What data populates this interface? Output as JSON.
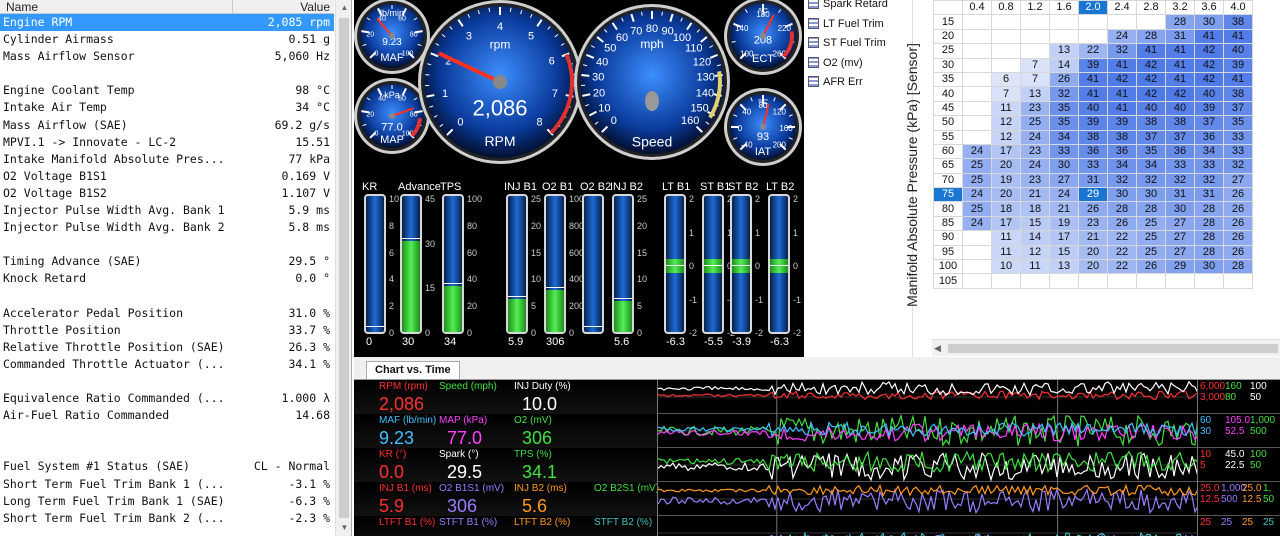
{
  "pid_table": {
    "col_name": "Name",
    "col_value": "Value",
    "rows": [
      {
        "name": "Engine RPM",
        "value": "2,085 rpm",
        "selected": true
      },
      {
        "name": "Cylinder Airmass",
        "value": "0.51 g"
      },
      {
        "name": "Mass Airflow Sensor",
        "value": "5,060 Hz"
      },
      {
        "name": "",
        "value": ""
      },
      {
        "name": "Engine Coolant Temp",
        "value": "98 °C"
      },
      {
        "name": "Intake Air Temp",
        "value": "34 °C"
      },
      {
        "name": "Mass Airflow (SAE)",
        "value": "69.2 g/s"
      },
      {
        "name": "MPVI.1 -> Innovate - LC-2",
        "value": "15.51"
      },
      {
        "name": "Intake Manifold Absolute Pres...",
        "value": "77 kPa"
      },
      {
        "name": "O2 Voltage B1S1",
        "value": "0.169 V"
      },
      {
        "name": "O2 Voltage B1S2",
        "value": "1.107 V"
      },
      {
        "name": "Injector Pulse Width Avg. Bank 1",
        "value": "5.9 ms"
      },
      {
        "name": "Injector Pulse Width Avg. Bank 2",
        "value": "5.8 ms"
      },
      {
        "name": "",
        "value": ""
      },
      {
        "name": "Timing Advance (SAE)",
        "value": "29.5 °"
      },
      {
        "name": "Knock Retard",
        "value": "0.0 °"
      },
      {
        "name": "",
        "value": ""
      },
      {
        "name": "Accelerator Pedal Position",
        "value": "31.0 %"
      },
      {
        "name": "Throttle Position",
        "value": "33.7 %"
      },
      {
        "name": "Relative Throttle Position (SAE)",
        "value": "26.3 %"
      },
      {
        "name": "Commanded Throttle Actuator (...",
        "value": "34.1 %"
      },
      {
        "name": "",
        "value": ""
      },
      {
        "name": "Equivalence Ratio Commanded (...",
        "value": "1.000 λ"
      },
      {
        "name": "Air-Fuel Ratio Commanded",
        "value": "14.68"
      },
      {
        "name": "",
        "value": ""
      },
      {
        "name": "",
        "value": ""
      },
      {
        "name": "Fuel System #1 Status (SAE)",
        "value": "CL - Normal"
      },
      {
        "name": "Short Term Fuel Trim Bank 1 (...",
        "value": "-3.1 %"
      },
      {
        "name": "Long Term Fuel Trim Bank 1 (SAE)",
        "value": "-6.3 %"
      },
      {
        "name": "Short Term Fuel Trim Bank 2 (...",
        "value": "-2.3 %"
      }
    ]
  },
  "gauges": {
    "maf": {
      "unit": "lb/min",
      "value": "9.23",
      "label": "MAF",
      "ticks": [
        "0",
        "20",
        "40",
        "60",
        "80",
        "100"
      ],
      "fraction": 0.35
    },
    "map": {
      "unit": "kPa",
      "value": "77.0",
      "label": "MAP",
      "ticks": [
        "0",
        "20",
        "40",
        "60",
        "80",
        "100"
      ],
      "fraction": 0.76
    },
    "rpm": {
      "unit": "rpm",
      "value": "2,086",
      "label": "RPM",
      "ticks": [
        "0",
        "1",
        "2",
        "3",
        "4",
        "5",
        "6",
        "7",
        "8"
      ],
      "fraction": 0.26
    },
    "speed": {
      "unit": "mph",
      "value": "",
      "label": "Speed",
      "ticks": [
        "0",
        "10",
        "20",
        "30",
        "40",
        "50",
        "60",
        "70",
        "80",
        "90",
        "100",
        "110",
        "120",
        "130",
        "140",
        "150",
        "160"
      ],
      "fraction": 0.0
    },
    "ect": {
      "unit": "°F",
      "value": "208",
      "label": "ECT",
      "ticks": [
        "100",
        "140",
        "180",
        "220",
        "260"
      ],
      "fraction": 0.6
    },
    "iat": {
      "unit": "°F",
      "value": "93",
      "label": "IAT",
      "ticks": [
        "-40",
        "0",
        "40",
        "80",
        "120",
        "160",
        "200"
      ],
      "fraction": 0.55
    }
  },
  "bars": [
    {
      "label": "KR",
      "value": "0",
      "fraction": 0.0,
      "ticks": [
        "10",
        "8",
        "6",
        "4",
        "2",
        "0"
      ]
    },
    {
      "label": "Advance",
      "value": "30",
      "fraction": 0.67,
      "ticks": [
        "45",
        "30",
        "15",
        "0"
      ]
    },
    {
      "label": "TPS",
      "value": "34",
      "fraction": 0.34,
      "ticks": [
        "100",
        "80",
        "60",
        "40",
        "20",
        "0"
      ]
    },
    {
      "label": "INJ B1",
      "value": "5.9",
      "fraction": 0.24,
      "ticks": [
        "25",
        "20",
        "15",
        "10",
        "5",
        "0"
      ]
    },
    {
      "label": "O2 B1",
      "value": "306",
      "fraction": 0.31,
      "ticks": [
        "1000",
        "800",
        "600",
        "400",
        "200",
        "0"
      ]
    },
    {
      "label": "O2 B2",
      "value": "",
      "fraction": 0.0,
      "ticks": []
    },
    {
      "label": "INJ B2",
      "value": "5.6",
      "fraction": 0.23,
      "ticks": [
        "25",
        "20",
        "15",
        "10",
        "5",
        "0"
      ]
    },
    {
      "label": "LT B1",
      "value": "-6.3",
      "fraction": 0.47,
      "ticks": [
        "2",
        "1",
        "0",
        "-1",
        "-2"
      ]
    },
    {
      "label": "ST B1",
      "value": "-5.5",
      "fraction": 0.47,
      "ticks": [
        "2",
        "1",
        "0",
        "-1",
        "-2"
      ]
    },
    {
      "label": "ST B2",
      "value": "-3.9",
      "fraction": 0.47,
      "ticks": [
        "2",
        "1",
        "0",
        "-1",
        "-2"
      ]
    },
    {
      "label": "LT B2",
      "value": "-6.3",
      "fraction": 0.47,
      "ticks": [
        "2",
        "1",
        "0",
        "-1",
        "-2"
      ]
    }
  ],
  "legend_items": [
    "Spark Retard",
    "LT Fuel Trim",
    "ST Fuel Trim",
    "O2 (mv)",
    "AFR Err"
  ],
  "map_table": {
    "ylabel": "Manifold Absolute Pressure (kPa) [Sensor]",
    "columns": [
      "0.4",
      "0.8",
      "1.2",
      "1.6",
      "2.0",
      "2.4",
      "2.8",
      "3.2",
      "3.6",
      "4.0"
    ],
    "selected_column": "2.0",
    "selected_row": "75",
    "rows": [
      {
        "kpa": "15",
        "cells": [
          "",
          "",
          "",
          "",
          "",
          "",
          "",
          "28",
          "30",
          "38"
        ]
      },
      {
        "kpa": "20",
        "cells": [
          "",
          "",
          "",
          "",
          "",
          "24",
          "28",
          "31",
          "41",
          "41"
        ]
      },
      {
        "kpa": "25",
        "cells": [
          "",
          "",
          "",
          "13",
          "22",
          "32",
          "41",
          "41",
          "42",
          "40"
        ]
      },
      {
        "kpa": "30",
        "cells": [
          "",
          "",
          "7",
          "14",
          "39",
          "41",
          "42",
          "41",
          "42",
          "39"
        ]
      },
      {
        "kpa": "35",
        "cells": [
          "",
          "6",
          "7",
          "26",
          "41",
          "42",
          "42",
          "41",
          "42",
          "41"
        ]
      },
      {
        "kpa": "40",
        "cells": [
          "",
          "7",
          "13",
          "32",
          "41",
          "41",
          "42",
          "42",
          "40",
          "38"
        ]
      },
      {
        "kpa": "45",
        "cells": [
          "",
          "11",
          "23",
          "35",
          "40",
          "41",
          "40",
          "40",
          "39",
          "37"
        ]
      },
      {
        "kpa": "50",
        "cells": [
          "",
          "12",
          "25",
          "35",
          "39",
          "39",
          "38",
          "38",
          "37",
          "35"
        ]
      },
      {
        "kpa": "55",
        "cells": [
          "",
          "12",
          "24",
          "34",
          "38",
          "38",
          "37",
          "37",
          "36",
          "33"
        ]
      },
      {
        "kpa": "60",
        "cells": [
          "24",
          "17",
          "23",
          "33",
          "36",
          "36",
          "35",
          "36",
          "34",
          "33"
        ]
      },
      {
        "kpa": "65",
        "cells": [
          "25",
          "20",
          "24",
          "30",
          "33",
          "34",
          "34",
          "33",
          "33",
          "32"
        ]
      },
      {
        "kpa": "70",
        "cells": [
          "25",
          "19",
          "23",
          "27",
          "31",
          "32",
          "32",
          "32",
          "32",
          "27"
        ]
      },
      {
        "kpa": "75",
        "cells": [
          "24",
          "20",
          "21",
          "24",
          "29",
          "30",
          "30",
          "31",
          "31",
          "26"
        ]
      },
      {
        "kpa": "80",
        "cells": [
          "25",
          "18",
          "18",
          "21",
          "26",
          "28",
          "28",
          "30",
          "28",
          "26"
        ]
      },
      {
        "kpa": "85",
        "cells": [
          "24",
          "17",
          "15",
          "19",
          "23",
          "26",
          "25",
          "27",
          "28",
          "26"
        ]
      },
      {
        "kpa": "90",
        "cells": [
          "",
          "11",
          "14",
          "17",
          "21",
          "22",
          "25",
          "27",
          "28",
          "26"
        ]
      },
      {
        "kpa": "95",
        "cells": [
          "",
          "11",
          "12",
          "15",
          "20",
          "22",
          "25",
          "27",
          "28",
          "26"
        ]
      },
      {
        "kpa": "100",
        "cells": [
          "",
          "10",
          "11",
          "13",
          "20",
          "22",
          "26",
          "29",
          "30",
          "28"
        ]
      },
      {
        "kpa": "105",
        "cells": [
          "",
          "",
          "",
          "",
          "",
          "",
          "",
          "",
          "",
          ""
        ]
      }
    ]
  },
  "chart": {
    "tab_label": "Chart vs. Time",
    "lanes": [
      {
        "items": [
          {
            "label": "RPM (rpm)",
            "value": "2,086",
            "color": "#ff3030"
          },
          {
            "label": "Speed (mph)",
            "value": "",
            "color": "#40e040"
          },
          {
            "label": "INJ Duty (%)",
            "value": "10.0",
            "color": "#ffffff"
          }
        ],
        "scale": [
          {
            "text": "6,000",
            "color": "#ff3030"
          },
          {
            "text": "160",
            "color": "#40e040"
          },
          {
            "text": "100",
            "color": "#ffffff"
          },
          {
            "text": "3,000",
            "color": "#ff3030"
          },
          {
            "text": "80",
            "color": "#40e040"
          },
          {
            "text": "50",
            "color": "#ffffff"
          }
        ]
      },
      {
        "items": [
          {
            "label": "MAF (lb/min)",
            "value": "9.23",
            "color": "#40c0ff"
          },
          {
            "label": "MAP (kPa)",
            "value": "77.0",
            "color": "#ff40ff"
          },
          {
            "label": "O2 (mV)",
            "value": "306",
            "color": "#40e040"
          }
        ],
        "scale": [
          {
            "text": "60",
            "color": "#40c0ff"
          },
          {
            "text": "105.0",
            "color": "#ff40ff"
          },
          {
            "text": "1,000",
            "color": "#40e040"
          },
          {
            "text": "30",
            "color": "#40c0ff"
          },
          {
            "text": "52.5",
            "color": "#ff40ff"
          },
          {
            "text": "500",
            "color": "#40e040"
          }
        ]
      },
      {
        "items": [
          {
            "label": "KR (°)",
            "value": "0.0",
            "color": "#ff3030"
          },
          {
            "label": "Spark (°)",
            "value": "29.5",
            "color": "#ffffff"
          },
          {
            "label": "TPS (%)",
            "value": "34.1",
            "color": "#40e040"
          }
        ],
        "scale": [
          {
            "text": "10",
            "color": "#ff3030"
          },
          {
            "text": "45.0",
            "color": "#ffffff"
          },
          {
            "text": "100",
            "color": "#40e040"
          },
          {
            "text": "5",
            "color": "#ff3030"
          },
          {
            "text": "22.5",
            "color": "#ffffff"
          },
          {
            "text": "50",
            "color": "#40e040"
          }
        ]
      },
      {
        "items": [
          {
            "label": "INJ B1 (ms)",
            "value": "5.9",
            "color": "#ff3030"
          },
          {
            "label": "O2 B1S1 (mV)",
            "value": "306",
            "color": "#9a7cff"
          },
          {
            "label": "INJ B2 (ms)",
            "value": "5.6",
            "color": "#ff9a20"
          },
          {
            "label": "O2 B2S1 (mV)",
            "value": "",
            "color": "#40e040"
          }
        ],
        "scale": [
          {
            "text": "25.0",
            "color": "#ff3030"
          },
          {
            "text": "1,000",
            "color": "#9a7cff"
          },
          {
            "text": "25.0",
            "color": "#ff9a20"
          },
          {
            "text": "1,",
            "color": "#40e040"
          },
          {
            "text": "12.5",
            "color": "#ff3030"
          },
          {
            "text": "500",
            "color": "#9a7cff"
          },
          {
            "text": "12.5",
            "color": "#ff9a20"
          },
          {
            "text": "50",
            "color": "#40e040"
          }
        ]
      },
      {
        "items": [
          {
            "label": "LTFT B1 (%)",
            "value": "",
            "color": "#ff3030"
          },
          {
            "label": "STFT B1 (%)",
            "value": "",
            "color": "#9a7cff"
          },
          {
            "label": "LTFT B2 (%)",
            "value": "",
            "color": "#ff9a20"
          },
          {
            "label": "STFT B2 (%)",
            "value": "",
            "color": "#40c0c0"
          }
        ],
        "scale": [
          {
            "text": "25",
            "color": "#ff3030"
          },
          {
            "text": "25",
            "color": "#9a7cff"
          },
          {
            "text": "25",
            "color": "#ff9a20"
          },
          {
            "text": "25",
            "color": "#40c0c0"
          }
        ]
      }
    ]
  }
}
